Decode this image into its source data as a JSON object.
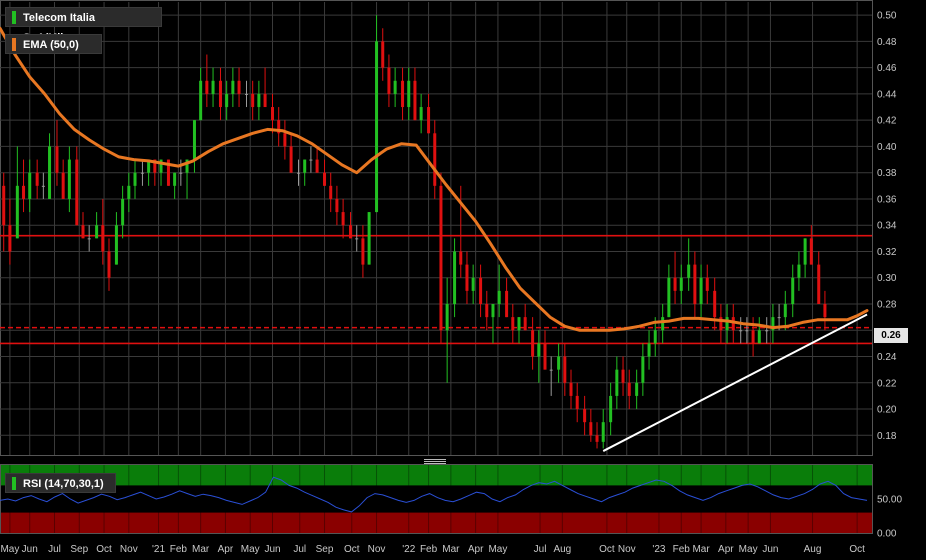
{
  "chart_data": [
    {
      "type": "candlestick",
      "title": "Telecom Italia SpA/Milano",
      "ylim": [
        0.165,
        0.51
      ],
      "y_ticks": [
        "0.18",
        "0.20",
        "0.22",
        "0.24",
        "0.26",
        "0.28",
        "0.30",
        "0.32",
        "0.34",
        "0.36",
        "0.38",
        "0.40",
        "0.42",
        "0.44",
        "0.46",
        "0.48",
        "0.50"
      ],
      "x_ticks": [
        "May",
        "Jun",
        "Jul",
        "Sep",
        "Oct",
        "Nov",
        "'21",
        "Feb",
        "Mar",
        "Apr",
        "May",
        "Jun",
        "Jul",
        "Sep",
        "Oct",
        "Nov",
        "'22",
        "Feb",
        "Mar",
        "Apr",
        "May",
        "Jul",
        "Aug",
        "Oct",
        "Nov",
        "'23",
        "Feb",
        "Mar",
        "Apr",
        "May",
        "Jun",
        "Aug",
        "Oct"
      ],
      "x_tick_pos": [
        0.4,
        1.2,
        2.2,
        3.2,
        4.2,
        5.2,
        6.4,
        7.2,
        8.1,
        9.1,
        10.1,
        11.0,
        12.1,
        13.1,
        14.2,
        15.2,
        16.5,
        17.3,
        18.2,
        19.2,
        20.1,
        21.8,
        22.7,
        24.5,
        25.3,
        26.6,
        27.5,
        28.3,
        29.3,
        30.2,
        31.1,
        32.8,
        34.6
      ],
      "current_price_label": "0.26",
      "current_price": 0.262,
      "colors": {
        "up": "#22c022",
        "down": "#e01010",
        "neutral": "#9a9a9a",
        "ema": "#e87722",
        "hline": "#e01010",
        "trend": "#ffffff",
        "grid": "#3a3a3a"
      },
      "horizontal_lines": [
        0.332,
        0.262,
        0.25
      ],
      "dashed_line": 0.262,
      "trendline": {
        "from": [
          24.35,
          0.168
        ],
        "to": [
          35.0,
          0.272
        ]
      },
      "ema": {
        "name": "EMA (50,0)",
        "x": [
          0,
          0.6,
          1.2,
          1.8,
          2.4,
          3.0,
          3.6,
          4.2,
          4.8,
          5.4,
          6.0,
          6.6,
          7.2,
          7.8,
          8.4,
          9.0,
          9.6,
          10.2,
          10.8,
          11.4,
          12.0,
          12.6,
          13.2,
          13.8,
          14.4,
          15.0,
          15.6,
          16.2,
          16.8,
          17.4,
          18.0,
          18.6,
          19.2,
          19.8,
          20.4,
          21.0,
          21.6,
          22.2,
          22.8,
          23.4,
          24.0,
          24.6,
          25.2,
          25.8,
          26.4,
          27.0,
          27.6,
          28.2,
          28.8,
          29.4,
          30.0,
          30.6,
          31.2,
          31.8,
          32.4,
          33.0,
          33.6,
          34.2,
          34.6,
          35.0
        ],
        "y": [
          0.49,
          0.47,
          0.453,
          0.44,
          0.425,
          0.413,
          0.405,
          0.398,
          0.392,
          0.39,
          0.389,
          0.387,
          0.385,
          0.389,
          0.396,
          0.402,
          0.406,
          0.41,
          0.413,
          0.412,
          0.408,
          0.402,
          0.394,
          0.386,
          0.38,
          0.39,
          0.398,
          0.402,
          0.401,
          0.386,
          0.371,
          0.357,
          0.343,
          0.326,
          0.308,
          0.292,
          0.281,
          0.27,
          0.263,
          0.26,
          0.26,
          0.26,
          0.261,
          0.263,
          0.266,
          0.267,
          0.269,
          0.269,
          0.268,
          0.267,
          0.265,
          0.264,
          0.262,
          0.263,
          0.266,
          0.268,
          0.268,
          0.268,
          0.271,
          0.275
        ]
      },
      "candles": [
        [
          0.15,
          0.37,
          0.38,
          0.32,
          0.34
        ],
        [
          0.4,
          0.34,
          0.36,
          0.31,
          0.32
        ],
        [
          0.7,
          0.33,
          0.4,
          0.33,
          0.37
        ],
        [
          0.95,
          0.37,
          0.39,
          0.35,
          0.36
        ],
        [
          1.2,
          0.36,
          0.39,
          0.35,
          0.38
        ],
        [
          1.5,
          0.38,
          0.39,
          0.36,
          0.37
        ],
        [
          1.75,
          0.37,
          0.38,
          0.36,
          0.37
        ],
        [
          2.0,
          0.36,
          0.41,
          0.36,
          0.4
        ],
        [
          2.3,
          0.4,
          0.42,
          0.37,
          0.38
        ],
        [
          2.55,
          0.38,
          0.39,
          0.36,
          0.36
        ],
        [
          2.8,
          0.36,
          0.4,
          0.35,
          0.39
        ],
        [
          3.1,
          0.39,
          0.4,
          0.34,
          0.34
        ],
        [
          3.35,
          0.34,
          0.35,
          0.33,
          0.33
        ],
        [
          3.6,
          0.33,
          0.34,
          0.32,
          0.33
        ],
        [
          3.9,
          0.33,
          0.35,
          0.33,
          0.34
        ],
        [
          4.15,
          0.34,
          0.36,
          0.31,
          0.32
        ],
        [
          4.4,
          0.32,
          0.33,
          0.29,
          0.3
        ],
        [
          4.7,
          0.31,
          0.35,
          0.31,
          0.34
        ],
        [
          4.95,
          0.34,
          0.37,
          0.33,
          0.36
        ],
        [
          5.2,
          0.36,
          0.38,
          0.35,
          0.37
        ],
        [
          5.45,
          0.37,
          0.39,
          0.36,
          0.38
        ],
        [
          5.75,
          0.38,
          0.39,
          0.37,
          0.38
        ],
        [
          6.0,
          0.38,
          0.39,
          0.37,
          0.39
        ],
        [
          6.25,
          0.39,
          0.39,
          0.37,
          0.38
        ],
        [
          6.5,
          0.38,
          0.39,
          0.37,
          0.39
        ],
        [
          6.8,
          0.39,
          0.39,
          0.37,
          0.37
        ],
        [
          7.05,
          0.37,
          0.38,
          0.36,
          0.38
        ],
        [
          7.3,
          0.38,
          0.39,
          0.37,
          0.38
        ],
        [
          7.55,
          0.38,
          0.39,
          0.36,
          0.39
        ],
        [
          7.85,
          0.39,
          0.42,
          0.38,
          0.42
        ],
        [
          8.1,
          0.42,
          0.46,
          0.42,
          0.45
        ],
        [
          8.35,
          0.45,
          0.47,
          0.43,
          0.44
        ],
        [
          8.6,
          0.44,
          0.46,
          0.43,
          0.45
        ],
        [
          8.9,
          0.45,
          0.46,
          0.42,
          0.43
        ],
        [
          9.15,
          0.43,
          0.45,
          0.42,
          0.44
        ],
        [
          9.4,
          0.44,
          0.46,
          0.43,
          0.45
        ],
        [
          9.65,
          0.45,
          0.46,
          0.43,
          0.44
        ],
        [
          9.95,
          0.44,
          0.45,
          0.43,
          0.44
        ],
        [
          10.2,
          0.44,
          0.45,
          0.42,
          0.43
        ],
        [
          10.45,
          0.43,
          0.45,
          0.42,
          0.44
        ],
        [
          10.7,
          0.44,
          0.46,
          0.43,
          0.43
        ],
        [
          11.0,
          0.43,
          0.44,
          0.41,
          0.42
        ],
        [
          11.25,
          0.42,
          0.43,
          0.4,
          0.41
        ],
        [
          11.5,
          0.41,
          0.42,
          0.39,
          0.4
        ],
        [
          11.75,
          0.4,
          0.41,
          0.38,
          0.38
        ],
        [
          12.05,
          0.38,
          0.39,
          0.37,
          0.38
        ],
        [
          12.3,
          0.38,
          0.39,
          0.37,
          0.39
        ],
        [
          12.55,
          0.39,
          0.4,
          0.38,
          0.39
        ],
        [
          12.8,
          0.39,
          0.4,
          0.38,
          0.38
        ],
        [
          13.1,
          0.38,
          0.39,
          0.37,
          0.37
        ],
        [
          13.35,
          0.37,
          0.38,
          0.35,
          0.36
        ],
        [
          13.6,
          0.36,
          0.37,
          0.34,
          0.35
        ],
        [
          13.85,
          0.35,
          0.36,
          0.33,
          0.34
        ],
        [
          14.15,
          0.34,
          0.35,
          0.33,
          0.33
        ],
        [
          14.4,
          0.33,
          0.34,
          0.32,
          0.33
        ],
        [
          14.65,
          0.33,
          0.34,
          0.3,
          0.31
        ],
        [
          14.9,
          0.31,
          0.35,
          0.31,
          0.35
        ],
        [
          15.2,
          0.35,
          0.5,
          0.35,
          0.48
        ],
        [
          15.45,
          0.48,
          0.49,
          0.45,
          0.46
        ],
        [
          15.7,
          0.46,
          0.47,
          0.43,
          0.44
        ],
        [
          15.95,
          0.44,
          0.46,
          0.43,
          0.45
        ],
        [
          16.25,
          0.45,
          0.46,
          0.42,
          0.43
        ],
        [
          16.5,
          0.43,
          0.46,
          0.42,
          0.45
        ],
        [
          16.75,
          0.45,
          0.46,
          0.42,
          0.42
        ],
        [
          17.0,
          0.42,
          0.44,
          0.41,
          0.43
        ],
        [
          17.3,
          0.43,
          0.44,
          0.41,
          0.41
        ],
        [
          17.55,
          0.41,
          0.42,
          0.36,
          0.37
        ],
        [
          17.8,
          0.37,
          0.38,
          0.25,
          0.26
        ],
        [
          18.05,
          0.26,
          0.3,
          0.22,
          0.28
        ],
        [
          18.35,
          0.28,
          0.33,
          0.27,
          0.32
        ],
        [
          18.6,
          0.32,
          0.37,
          0.3,
          0.31
        ],
        [
          18.85,
          0.31,
          0.32,
          0.28,
          0.29
        ],
        [
          19.1,
          0.29,
          0.31,
          0.28,
          0.3
        ],
        [
          19.4,
          0.3,
          0.31,
          0.27,
          0.28
        ],
        [
          19.65,
          0.28,
          0.29,
          0.26,
          0.27
        ],
        [
          19.9,
          0.27,
          0.28,
          0.25,
          0.28
        ],
        [
          20.15,
          0.28,
          0.31,
          0.27,
          0.29
        ],
        [
          20.45,
          0.29,
          0.3,
          0.27,
          0.27
        ],
        [
          20.7,
          0.27,
          0.28,
          0.25,
          0.26
        ],
        [
          20.95,
          0.26,
          0.27,
          0.25,
          0.27
        ],
        [
          21.2,
          0.27,
          0.28,
          0.26,
          0.26
        ],
        [
          21.5,
          0.26,
          0.27,
          0.23,
          0.24
        ],
        [
          21.75,
          0.24,
          0.26,
          0.22,
          0.25
        ],
        [
          22.0,
          0.25,
          0.26,
          0.23,
          0.23
        ],
        [
          22.25,
          0.23,
          0.24,
          0.21,
          0.23
        ],
        [
          22.55,
          0.23,
          0.25,
          0.22,
          0.24
        ],
        [
          22.8,
          0.24,
          0.25,
          0.21,
          0.22
        ],
        [
          23.05,
          0.22,
          0.23,
          0.2,
          0.21
        ],
        [
          23.3,
          0.21,
          0.22,
          0.19,
          0.2
        ],
        [
          23.6,
          0.2,
          0.21,
          0.18,
          0.19
        ],
        [
          23.85,
          0.19,
          0.2,
          0.175,
          0.18
        ],
        [
          24.1,
          0.18,
          0.19,
          0.17,
          0.175
        ],
        [
          24.35,
          0.175,
          0.2,
          0.17,
          0.19
        ],
        [
          24.65,
          0.19,
          0.22,
          0.18,
          0.21
        ],
        [
          24.9,
          0.21,
          0.24,
          0.2,
          0.23
        ],
        [
          25.15,
          0.23,
          0.24,
          0.21,
          0.22
        ],
        [
          25.4,
          0.22,
          0.23,
          0.2,
          0.21
        ],
        [
          25.7,
          0.21,
          0.23,
          0.2,
          0.22
        ],
        [
          25.95,
          0.22,
          0.25,
          0.21,
          0.24
        ],
        [
          26.2,
          0.24,
          0.26,
          0.23,
          0.25
        ],
        [
          26.45,
          0.25,
          0.27,
          0.24,
          0.26
        ],
        [
          26.75,
          0.26,
          0.28,
          0.25,
          0.27
        ],
        [
          27.0,
          0.27,
          0.31,
          0.27,
          0.3
        ],
        [
          27.25,
          0.3,
          0.32,
          0.28,
          0.29
        ],
        [
          27.5,
          0.29,
          0.31,
          0.28,
          0.3
        ],
        [
          27.8,
          0.3,
          0.33,
          0.29,
          0.31
        ],
        [
          28.05,
          0.31,
          0.32,
          0.27,
          0.28
        ],
        [
          28.3,
          0.28,
          0.31,
          0.27,
          0.3
        ],
        [
          28.55,
          0.3,
          0.31,
          0.28,
          0.29
        ],
        [
          28.85,
          0.29,
          0.3,
          0.26,
          0.27
        ],
        [
          29.1,
          0.27,
          0.28,
          0.25,
          0.26
        ],
        [
          29.35,
          0.26,
          0.28,
          0.25,
          0.27
        ],
        [
          29.6,
          0.27,
          0.28,
          0.25,
          0.26
        ],
        [
          29.9,
          0.26,
          0.27,
          0.25,
          0.26
        ],
        [
          30.15,
          0.26,
          0.27,
          0.25,
          0.26
        ],
        [
          30.4,
          0.26,
          0.27,
          0.24,
          0.25
        ],
        [
          30.65,
          0.25,
          0.27,
          0.25,
          0.26
        ],
        [
          30.95,
          0.26,
          0.27,
          0.25,
          0.26
        ],
        [
          31.2,
          0.26,
          0.28,
          0.25,
          0.27
        ],
        [
          31.45,
          0.27,
          0.28,
          0.26,
          0.27
        ],
        [
          31.7,
          0.27,
          0.29,
          0.26,
          0.28
        ],
        [
          32.0,
          0.28,
          0.31,
          0.27,
          0.3
        ],
        [
          32.25,
          0.3,
          0.32,
          0.29,
          0.31
        ],
        [
          32.5,
          0.31,
          0.33,
          0.3,
          0.33
        ],
        [
          32.75,
          0.33,
          0.34,
          0.31,
          0.31
        ],
        [
          33.05,
          0.31,
          0.32,
          0.28,
          0.28
        ],
        [
          33.3,
          0.28,
          0.29,
          0.26,
          0.27
        ]
      ]
    },
    {
      "type": "line",
      "title": "RSI (14,70,30,1)",
      "ylim": [
        0,
        100
      ],
      "y_ticks": [
        "0.00",
        "50.00"
      ],
      "bands": [
        {
          "from": 70,
          "to": 100,
          "color": "#0a7d0a"
        },
        {
          "from": 0,
          "to": 30,
          "color": "#8a0000"
        }
      ],
      "line_color": "#2a4fd6",
      "y": [
        48,
        50,
        47,
        52,
        55,
        50,
        46,
        53,
        58,
        50,
        44,
        48,
        52,
        57,
        54,
        49,
        52,
        56,
        60,
        55,
        50,
        53,
        57,
        62,
        58,
        54,
        57,
        55,
        52,
        48,
        45,
        42,
        47,
        52,
        60,
        82,
        78,
        70,
        66,
        60,
        55,
        50,
        45,
        38,
        34,
        31,
        40,
        52,
        58,
        56,
        52,
        48,
        45,
        48,
        54,
        58,
        52,
        48,
        46,
        50,
        55,
        60,
        58,
        50,
        46,
        52,
        56,
        64,
        70,
        74,
        72,
        76,
        70,
        64,
        58,
        54,
        50,
        46,
        52,
        56,
        60,
        66,
        70,
        74,
        78,
        76,
        70,
        62,
        56,
        52,
        48,
        52,
        58,
        62,
        66,
        70,
        72,
        68,
        62,
        56,
        52,
        50,
        54,
        58,
        64,
        72,
        76,
        70,
        58,
        52,
        50,
        48
      ]
    }
  ]
}
